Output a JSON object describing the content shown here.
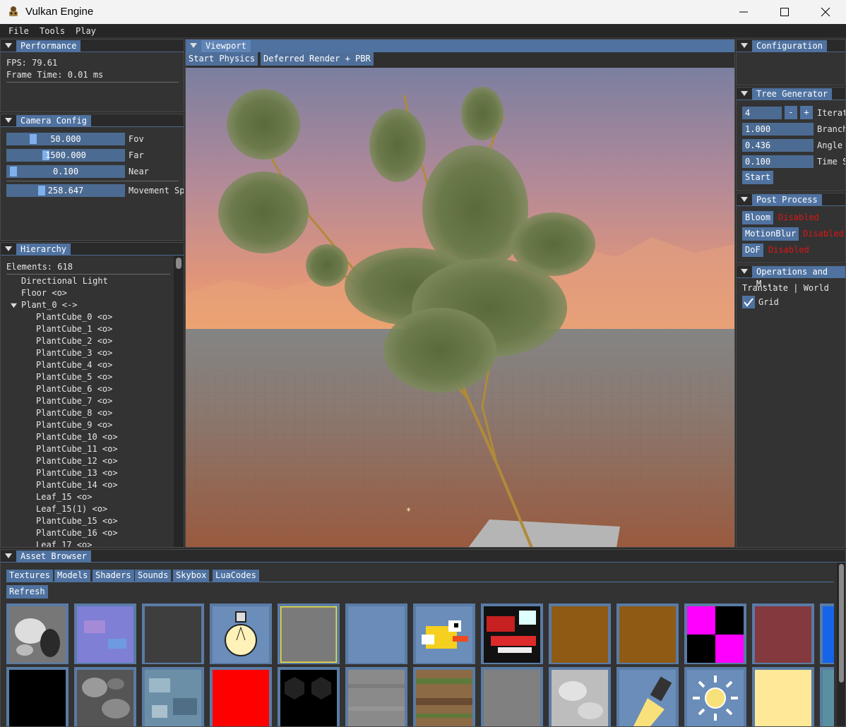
{
  "window": {
    "title": "Vulkan Engine"
  },
  "menu": [
    "File",
    "Tools",
    "Play"
  ],
  "performance": {
    "tab": "Performance",
    "fps": "FPS: 79.61",
    "frame_time": "Frame Time: 0.01 ms"
  },
  "camera": {
    "tab": "Camera Config",
    "sliders": [
      {
        "value": "50.000",
        "label": "Fov",
        "fraction": 0.2
      },
      {
        "value": "1500.000",
        "label": "Far",
        "fraction": 0.32
      },
      {
        "value": "0.100",
        "label": "Near",
        "fraction": 0.02
      },
      {
        "value": "258.647",
        "label": "Movement Sp",
        "fraction": 0.28
      }
    ]
  },
  "hierarchy": {
    "tab": "Hierarchy",
    "count": "Elements: 618",
    "items": [
      {
        "label": "Directional Light",
        "depth": 1
      },
      {
        "label": "Floor <o>",
        "depth": 1
      },
      {
        "label": "Plant_0 <->",
        "depth": 0,
        "expanded": true
      },
      {
        "label": "PlantCube_0 <o>",
        "depth": 2
      },
      {
        "label": "PlantCube_1 <o>",
        "depth": 2
      },
      {
        "label": "PlantCube_2 <o>",
        "depth": 2
      },
      {
        "label": "PlantCube_3 <o>",
        "depth": 2
      },
      {
        "label": "PlantCube_4 <o>",
        "depth": 2
      },
      {
        "label": "PlantCube_5 <o>",
        "depth": 2
      },
      {
        "label": "PlantCube_6 <o>",
        "depth": 2
      },
      {
        "label": "PlantCube_7 <o>",
        "depth": 2
      },
      {
        "label": "PlantCube_8 <o>",
        "depth": 2
      },
      {
        "label": "PlantCube_9 <o>",
        "depth": 2
      },
      {
        "label": "PlantCube_10 <o>",
        "depth": 2
      },
      {
        "label": "PlantCube_11 <o>",
        "depth": 2
      },
      {
        "label": "PlantCube_12 <o>",
        "depth": 2
      },
      {
        "label": "PlantCube_13 <o>",
        "depth": 2
      },
      {
        "label": "PlantCube_14 <o>",
        "depth": 2
      },
      {
        "label": "Leaf_15 <o>",
        "depth": 2
      },
      {
        "label": "Leaf_15(1) <o>",
        "depth": 2
      },
      {
        "label": "PlantCube_15 <o>",
        "depth": 2
      },
      {
        "label": "PlantCube_16 <o>",
        "depth": 2
      },
      {
        "label": "Leaf_17 <o>",
        "depth": 2
      }
    ]
  },
  "viewport": {
    "tab": "Viewport",
    "start_physics": "Start Physics",
    "render_mode": "Deferred Render + PBR"
  },
  "configuration": {
    "tab": "Configuration"
  },
  "tree_generator": {
    "tab": "Tree Generator",
    "iterations_value": "4",
    "minus": "-",
    "plus": "+",
    "iterations_label": "Iterat",
    "rows": [
      {
        "value": "1.000",
        "label": "Branch"
      },
      {
        "value": "0.436",
        "label": "Angle"
      },
      {
        "value": "0.100",
        "label": "Time S"
      }
    ],
    "start": "Start"
  },
  "post_process": {
    "tab": "Post Process",
    "effects": [
      {
        "name": "Bloom",
        "status": "Disabled"
      },
      {
        "name": "MotionBlur",
        "status": "Disabled"
      },
      {
        "name": "DoF",
        "status": "Disabled"
      }
    ],
    "status_color": "#e01515"
  },
  "operations": {
    "tab": "Operations and M...",
    "mode": "Translate | World",
    "grid_label": "Grid",
    "grid_checked": true
  },
  "assets": {
    "tab": "Asset Browser",
    "tabs": [
      "Textures",
      "Models",
      "Shaders",
      "Sounds",
      "Skybox",
      "LuaCodes"
    ],
    "refresh": "Refresh",
    "thumbs_row1": [
      "noise-bw",
      "normal-map",
      "dark-gray",
      "light-bulb-icon",
      "gray-selected",
      "blue-flat",
      "pixel-bird-icon",
      "red-sprite",
      "brown",
      "brown",
      "magenta-checker",
      "maroon",
      "blue-strip"
    ],
    "thumbs_row2": [
      "black",
      "cloud-gray",
      "ice-rock",
      "red",
      "black-hex",
      "gray-noise",
      "bark",
      "mid-gray",
      "white-noise",
      "flashlight-icon",
      "sun-icon",
      "pale-yellow",
      "teal-strip"
    ]
  },
  "colors": {
    "accent": "#4f72a0",
    "panel": "#333333",
    "header": "#2a2a2a"
  }
}
